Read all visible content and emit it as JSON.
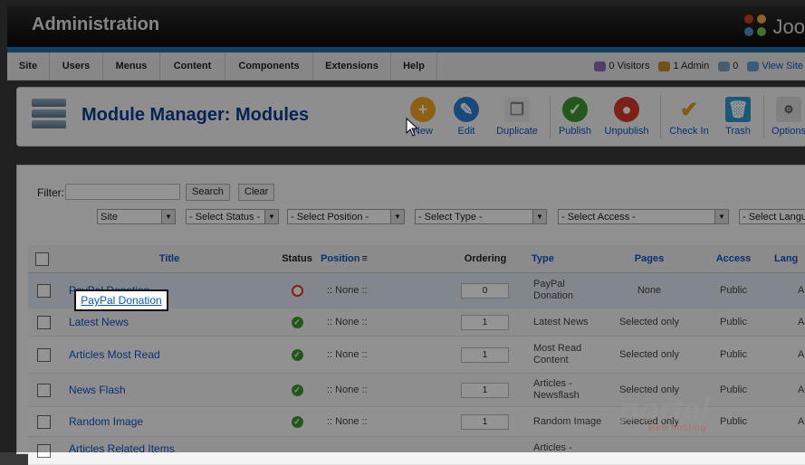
{
  "header": {
    "title": "Administration",
    "brand": "Joo"
  },
  "menu": [
    "Site",
    "Users",
    "Menus",
    "Content",
    "Components",
    "Extensions",
    "Help"
  ],
  "status": {
    "visitors": "0 Visitors",
    "admins": "1 Admin",
    "messages": "0",
    "view_site": "View Site"
  },
  "toolbar": {
    "page_title": "Module Manager: Modules",
    "buttons": [
      "New",
      "Edit",
      "Duplicate",
      "Publish",
      "Unpublish",
      "Check In",
      "Trash",
      "Options"
    ]
  },
  "filter": {
    "label": "Filter:",
    "search_button": "Search",
    "clear_button": "Clear",
    "selects": [
      "Site",
      "- Select Status -",
      "- Select Position -",
      "- Select Type -",
      "- Select Access -",
      "- Select Langu"
    ]
  },
  "table": {
    "headers": [
      "Title",
      "Status",
      "Position",
      "Ordering",
      "Type",
      "Pages",
      "Access",
      "Lang"
    ],
    "rows": [
      {
        "title": "PayPal Donation",
        "status": "unpublished",
        "position": ":: None ::",
        "ordering": "0",
        "type": "PayPal Donation",
        "pages": "None",
        "access": "Public",
        "lang": "A"
      },
      {
        "title": "Latest News",
        "status": "published",
        "position": ":: None ::",
        "ordering": "1",
        "type": "Latest News",
        "pages": "Selected only",
        "access": "Public",
        "lang": "A"
      },
      {
        "title": "Articles Most Read",
        "status": "published",
        "position": ":: None ::",
        "ordering": "1",
        "type": "Most Read Content",
        "pages": "Selected only",
        "access": "Public",
        "lang": "A"
      },
      {
        "title": "News Flash",
        "status": "published",
        "position": ":: None ::",
        "ordering": "1",
        "type": "Articles - Newsflash",
        "pages": "Selected only",
        "access": "Public",
        "lang": "A"
      },
      {
        "title": "Random Image",
        "status": "published",
        "position": ":: None ::",
        "ordering": "1",
        "type": "Random Image",
        "pages": "Selected only",
        "access": "Public",
        "lang": "A"
      },
      {
        "title": "Articles Related Items",
        "status": "published",
        "position": "",
        "ordering": "",
        "type": "Articles -",
        "pages": "",
        "access": "",
        "lang": ""
      }
    ]
  },
  "highlight_label": "PayPal Donation",
  "watermark": {
    "text": "portal",
    "sub": "web hosting"
  }
}
